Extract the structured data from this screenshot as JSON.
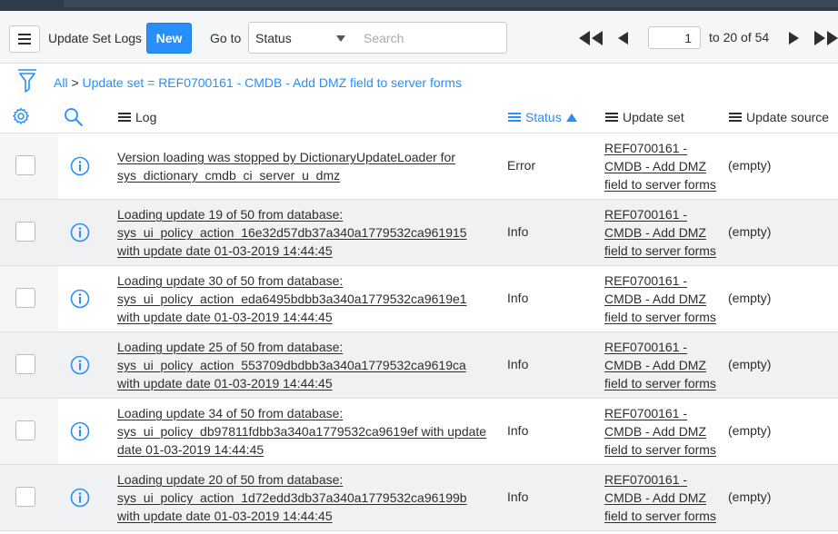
{
  "header": {
    "title": "Update Set Logs",
    "new_label": "New",
    "goto_label": "Go to",
    "goto_field": "Status",
    "search_placeholder": "Search",
    "page_value": "1",
    "page_range": "to 20 of 54"
  },
  "breadcrumb": {
    "all": "All",
    "sep": " > ",
    "filter": "Update set = REF0700161 - CMDB - Add DMZ field to server forms"
  },
  "columns": {
    "log": "Log",
    "status": "Status",
    "update_set": "Update set",
    "update_source": "Update source"
  },
  "rows": [
    {
      "log": "Version loading was stopped by DictionaryUpdateLoader for sys_dictionary_cmdb_ci_server_u_dmz",
      "status": "Error",
      "update_set": "REF0700161 - CMDB - Add DMZ field to server forms",
      "update_source": "(empty)"
    },
    {
      "log": "Loading update 19 of 50 from database: sys_ui_policy_action_16e32d57db37a340a1779532ca961915 with update date 01-03-2019 14:44:45",
      "status": "Info",
      "update_set": "REF0700161 - CMDB - Add DMZ field to server forms",
      "update_source": "(empty)"
    },
    {
      "log": "Loading update 30 of 50 from database: sys_ui_policy_action_eda6495bdbb3a340a1779532ca9619e1 with update date 01-03-2019 14:44:45",
      "status": "Info",
      "update_set": "REF0700161 - CMDB - Add DMZ field to server forms",
      "update_source": "(empty)"
    },
    {
      "log": "Loading update 25 of 50 from database: sys_ui_policy_action_553709dbdbb3a340a1779532ca9619ca with update date 01-03-2019 14:44:45",
      "status": "Info",
      "update_set": "REF0700161 - CMDB - Add DMZ field to server forms",
      "update_source": "(empty)"
    },
    {
      "log": "Loading update 34 of 50 from database: sys_ui_policy_db97811fdbb3a340a1779532ca9619ef with update date 01-03-2019 14:44:45",
      "status": "Info",
      "update_set": "REF0700161 - CMDB - Add DMZ field to server forms",
      "update_source": "(empty)"
    },
    {
      "log": "Loading update 20 of 50 from database: sys_ui_policy_action_1d72edd3db37a340a1779532ca96199b with update date 01-03-2019 14:44:45",
      "status": "Info",
      "update_set": "REF0700161 - CMDB - Add DMZ field to server forms",
      "update_source": "(empty)"
    }
  ],
  "colors": {
    "accent": "#278efc",
    "header_bg": "#f5f6f7",
    "topbar": "#2e3d49"
  },
  "icons": {
    "menu": "hamburger-menu-icon",
    "filter": "funnel-icon",
    "settings": "gear-icon",
    "search": "magnifier-icon",
    "info": "info-circle-icon"
  }
}
